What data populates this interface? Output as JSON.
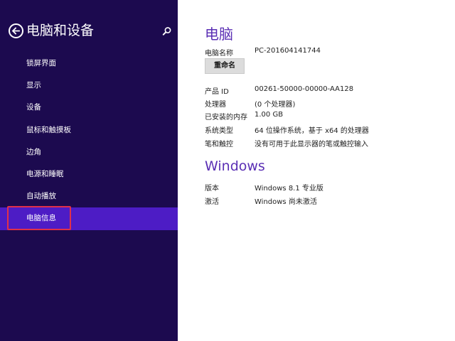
{
  "sidebar": {
    "title": "电脑和设备",
    "items": [
      {
        "label": "锁屏界面"
      },
      {
        "label": "显示"
      },
      {
        "label": "设备"
      },
      {
        "label": "鼠标和触摸板"
      },
      {
        "label": "边角"
      },
      {
        "label": "电源和睡眠"
      },
      {
        "label": "自动播放"
      },
      {
        "label": "电脑信息",
        "selected": true
      }
    ]
  },
  "pc_section": {
    "title": "电脑",
    "computer_name_label": "电脑名称",
    "computer_name_value": "PC-201604141744",
    "rename_label": "重命名",
    "specs": [
      {
        "label": "产品 ID",
        "value": "00261-50000-00000-AA128"
      },
      {
        "label": "处理器",
        "value": "(0 个处理器)"
      },
      {
        "label": "已安装的内存",
        "value": "1.00 GB"
      },
      {
        "label": "系统类型",
        "value": "64 位操作系统，基于 x64 的处理器"
      },
      {
        "label": "笔和触控",
        "value": "没有可用于此显示器的笔或触控输入"
      }
    ]
  },
  "windows_section": {
    "title": "Windows",
    "rows": [
      {
        "label": "版本",
        "value": "Windows 8.1 专业版"
      },
      {
        "label": "激活",
        "value": "Windows 尚未激活"
      }
    ]
  },
  "colors": {
    "sidebar_bg": "#1c0a4f",
    "selected_bg": "#4d1cc5",
    "accent_title": "#5a2eb4",
    "highlight_border": "#e0304a"
  },
  "icons": {
    "back": "back-arrow-icon",
    "search": "search-icon"
  }
}
